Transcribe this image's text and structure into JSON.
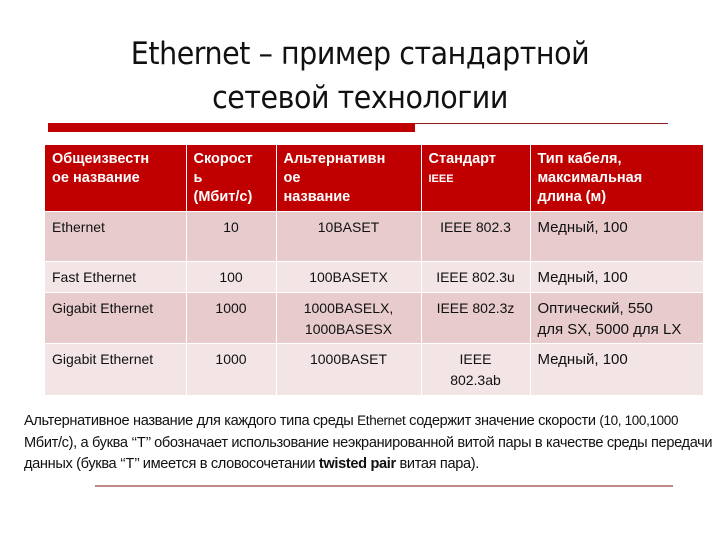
{
  "slide": {
    "title_line1": "Ethernet – пример стандартной",
    "title_line2": "сетевой технологии",
    "accent_color": "#c00000"
  },
  "table": {
    "headers": [
      {
        "text": "Общеизвестное название"
      },
      {
        "text": "Скорость (Мбит/с)"
      },
      {
        "text": "Альтернативное название"
      },
      {
        "text": "Стандарт",
        "sub": "IEEE"
      },
      {
        "text": "Тип кабеля, максимальная длина (м)"
      }
    ],
    "header_display": {
      "col1": [
        "Общеизвестн",
        "ое название"
      ],
      "col2": [
        "Скорост",
        "ь",
        "(Мбит/с)"
      ],
      "col3": [
        "Альтернативн",
        "ое",
        "название"
      ],
      "col4": [
        "Стандарт",
        "IEEE"
      ],
      "col5": [
        "Тип кабеля,",
        "максимальная",
        "длина (м)"
      ]
    },
    "rows": [
      {
        "name": "Ethernet",
        "speed": "10",
        "alt_name": "10BASET",
        "standard": "IEEE 802.3",
        "cable": "Медный, 100"
      },
      {
        "name": "Fast Ethernet",
        "speed": "100",
        "alt_name": "100BASETX",
        "standard": "IEEE 802.3u",
        "cable": "Медный, 100"
      },
      {
        "name": "Gigabit Ethernet",
        "speed": "1000",
        "alt_name": "1000BASELX, 1000BASESX",
        "standard": "IEEE 802.3z",
        "cable": "Оптический, 550 для SX, 5000 для LX"
      },
      {
        "name": "Gigabit Ethernet",
        "speed": "1000",
        "alt_name": "1000BASET",
        "standard": "IEEE 802.3ab",
        "cable": "Медный, 100"
      }
    ],
    "row_display": {
      "r3_alt_line1": "1000BASELX,",
      "r3_alt_line2": "1000BASESX",
      "r3_cable_line1": "Оптический, 550",
      "r3_cable_line2": "для SX, 5000 для LX",
      "r4_std_line1": "IEEE",
      "r4_std_line2": "802.3ab"
    }
  },
  "note": {
    "part1": "Альтернативное  название для каждого типа среды ",
    "part2": "Ethernet",
    "part3": " содержит значение скорости ",
    "part4": "(10, 100,1000",
    "part5": " Мбит/с), а буква ‘‘Т’’ обозначает использование неэкранированной витой пары в качестве среды передачи данных (буква ‘‘Т’’ имеется в словосочетании ",
    "bold": "twisted pair",
    "part6": " витая пара)."
  }
}
